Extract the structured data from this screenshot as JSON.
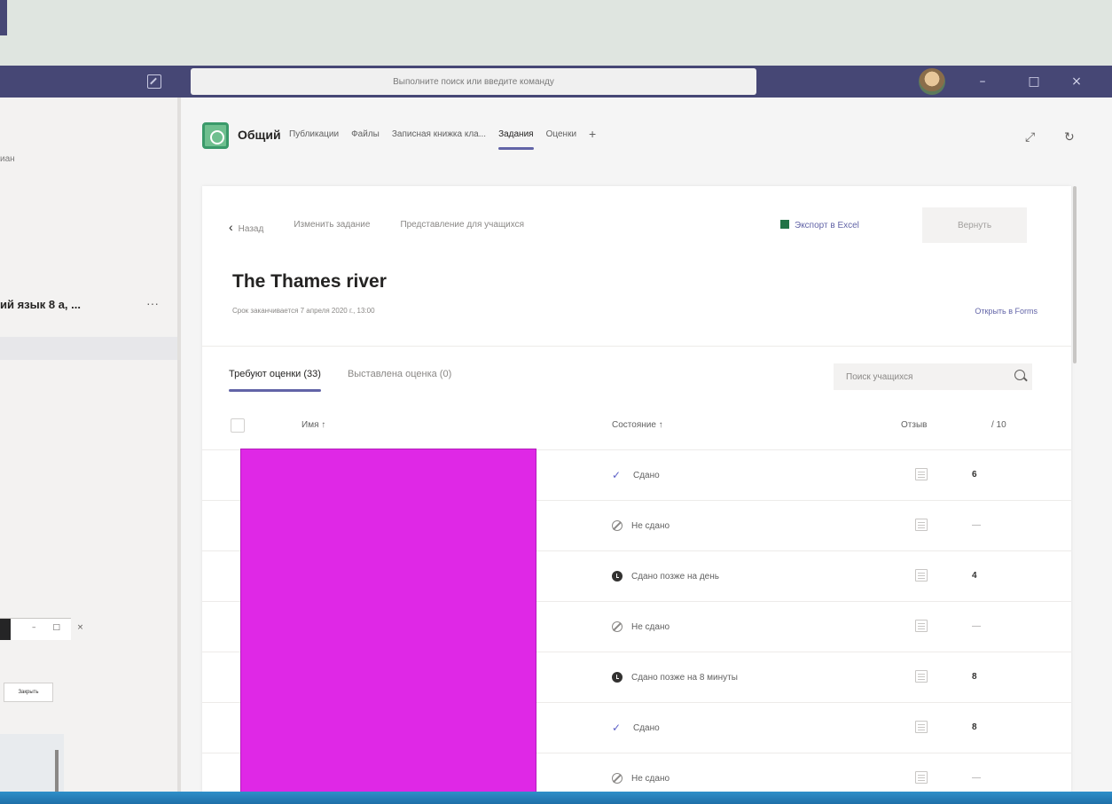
{
  "window": {
    "search_placeholder": "Выполните поиск или введите команду",
    "minimize": "–",
    "maximize": "□",
    "close": "×"
  },
  "left_panel": {
    "top_label": "иан",
    "team_name": "ий язык 8 а, ...",
    "more": "···"
  },
  "channel": {
    "name": "Общий",
    "tabs": [
      {
        "label": "Публикации"
      },
      {
        "label": "Файлы"
      },
      {
        "label": "Записная книжка кла..."
      },
      {
        "label": "Задания"
      },
      {
        "label": "Оценки"
      }
    ],
    "active_tab": "Задания",
    "add": "+"
  },
  "assignment": {
    "back": "Назад",
    "edit": "Изменить задание",
    "student_view": "Представление для учащихся",
    "export": "Экспорт в Excel",
    "return_button": "Вернуть",
    "title": "The Thames river",
    "due": "Срок заканчивается 7 апреля 2020 г., 13:00",
    "open_forms": "Открыть в Forms",
    "tab_needs_grading": "Требуют оценки (33)",
    "tab_graded": "Выставлена оценка (0)",
    "search_placeholder": "Поиск учащихся",
    "columns": {
      "name": "Имя ↑",
      "status": "Состояние ↑",
      "feedback": "Отзыв",
      "score": "/ 10"
    },
    "rows": [
      {
        "status": "Сдано",
        "icon": "check-icon",
        "score": "6"
      },
      {
        "status": "Не сдано",
        "icon": "not-turned-in-icon",
        "score": "—"
      },
      {
        "status": "Сдано позже на день",
        "icon": "late-clock-icon",
        "score": "4"
      },
      {
        "status": "Не сдано",
        "icon": "not-turned-in-icon",
        "score": "—"
      },
      {
        "status": "Сдано позже на 8 минуты",
        "icon": "late-clock-icon",
        "score": "8"
      },
      {
        "status": "Сдано",
        "icon": "check-icon",
        "score": "8"
      },
      {
        "status": "Не сдано",
        "icon": "not-turned-in-icon",
        "score": "—"
      }
    ]
  },
  "small_window": {
    "buttons": "– □ ×",
    "close_button": "Закрыть"
  },
  "colors": {
    "accent": "#6264a7",
    "title_bar": "#464775",
    "redaction": "#df28e6"
  }
}
